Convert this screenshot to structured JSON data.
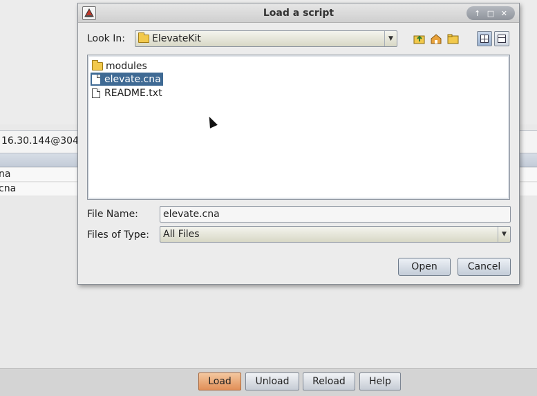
{
  "background": {
    "address_text": "16.30.144@304",
    "rows": [
      "na",
      "cna"
    ],
    "footer_buttons": [
      {
        "label": "Load",
        "active": true
      },
      {
        "label": "Unload",
        "active": false
      },
      {
        "label": "Reload",
        "active": false
      },
      {
        "label": "Help",
        "active": false
      }
    ]
  },
  "dialog": {
    "title": "Load a script",
    "window_controls": [
      "up-arrow-icon",
      "restore-icon",
      "close-icon"
    ],
    "look_in_label": "Look In:",
    "look_in_value": "ElevateKit",
    "toolbar_icons": [
      "up-folder-icon",
      "home-icon",
      "new-folder-icon",
      "list-view-icon",
      "details-view-icon"
    ],
    "files": [
      {
        "name": "modules",
        "type": "folder",
        "selected": false
      },
      {
        "name": "elevate.cna",
        "type": "file",
        "selected": true
      },
      {
        "name": "README.txt",
        "type": "file",
        "selected": false
      }
    ],
    "file_name_label": "File Name:",
    "file_name_value": "elevate.cna",
    "files_of_type_label": "Files of Type:",
    "files_of_type_value": "All Files",
    "open_label": "Open",
    "cancel_label": "Cancel"
  }
}
